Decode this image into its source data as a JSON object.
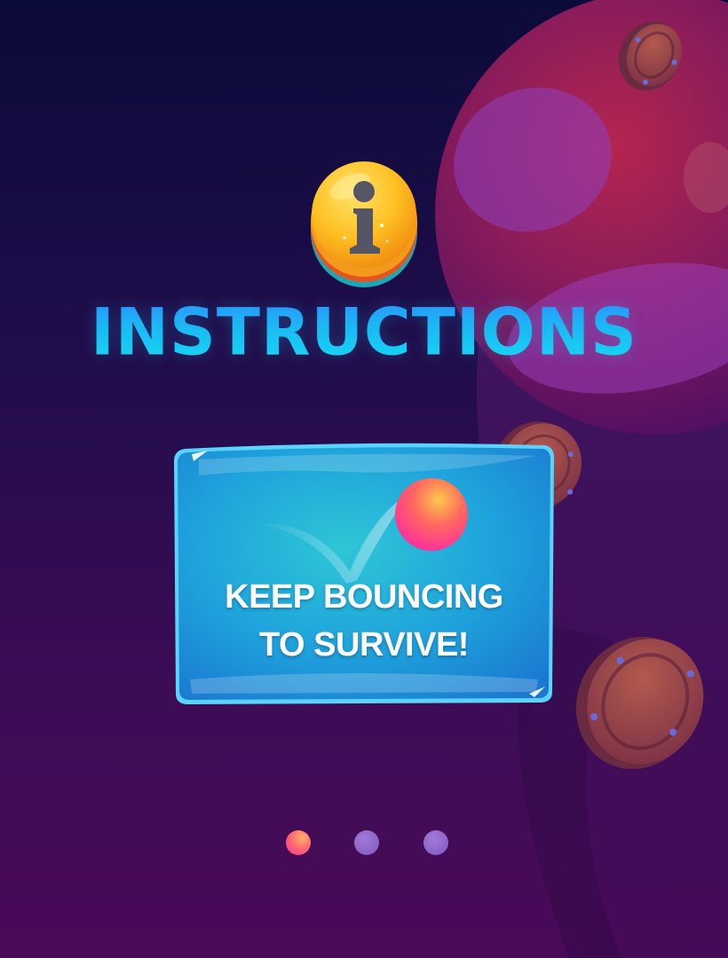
{
  "screen": {
    "title": "INSTRUCTIONS",
    "info_icon": "info-icon"
  },
  "card": {
    "lines": [
      "KEEP BOUNCING",
      "TO SURVIVE!"
    ],
    "ball_icon": "bouncing-ball-icon"
  },
  "pagination": {
    "total_pages": 3,
    "current_page": 1
  },
  "colors": {
    "title_gradient": [
      "#2f86ff",
      "#14e0f2"
    ],
    "card_blue": "#1a8fdb",
    "ball": [
      "#ffb84a",
      "#ff2ea0"
    ],
    "active_dot": "#ff4d80",
    "inactive_dot": "#8a62c8",
    "background": [
      "#0b0b3a",
      "#4a0a58"
    ]
  }
}
